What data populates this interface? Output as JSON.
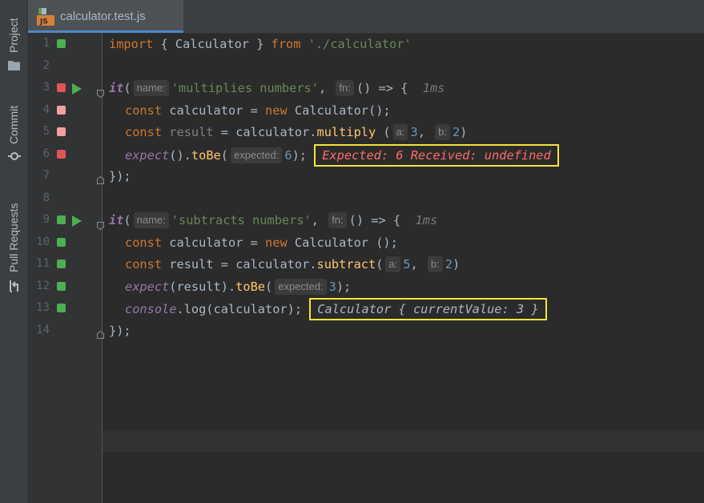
{
  "sidebar": {
    "tabs": [
      {
        "label": "Project",
        "icon": "folder-icon"
      },
      {
        "label": "Commit",
        "icon": "commit-icon"
      },
      {
        "label": "Pull Requests",
        "icon": "pull-request-icon"
      }
    ]
  },
  "tabs": [
    {
      "label": "calculator.test.js",
      "icon": "js-file-icon",
      "active": true
    }
  ],
  "gutter": {
    "lines": [
      {
        "num": "1",
        "status": "pass"
      },
      {
        "num": "2",
        "status": "none"
      },
      {
        "num": "3",
        "status": "fail",
        "run": true
      },
      {
        "num": "4",
        "status": "fail-light"
      },
      {
        "num": "5",
        "status": "fail-light"
      },
      {
        "num": "6",
        "status": "fail"
      },
      {
        "num": "7",
        "status": "none"
      },
      {
        "num": "8",
        "status": "none"
      },
      {
        "num": "9",
        "status": "pass",
        "run": true
      },
      {
        "num": "10",
        "status": "pass"
      },
      {
        "num": "11",
        "status": "pass"
      },
      {
        "num": "12",
        "status": "pass"
      },
      {
        "num": "13",
        "status": "pass"
      },
      {
        "num": "14",
        "status": "none"
      }
    ]
  },
  "code": {
    "l1": {
      "kw_import": "import",
      "braces": "{ Calculator }",
      "kw_from": "from",
      "path": "'./calculator'"
    },
    "l3": {
      "it": "it",
      "hint_name": "name:",
      "name": "'multiplies numbers'",
      "hint_fn": "fn:",
      "arrow": "() => {",
      "timing": "1ms"
    },
    "l4": {
      "kw": "const",
      "ident": "calculator",
      "eq": "=",
      "kw_new": "new",
      "call": "Calculator();"
    },
    "l5": {
      "kw": "const",
      "ident": "result",
      "eq": "=",
      "obj": "calculator.",
      "method": "multiply",
      "open": " (",
      "hint_a": "a:",
      "a": "3",
      "hint_b": "b:",
      "b": "2",
      "close": ")"
    },
    "l6": {
      "expect": "expect",
      "mid": "().",
      "tobe": "toBe",
      "open": "(",
      "hint_expected": "expected:",
      "val": "6",
      "close": ");",
      "result": "Expected: 6 Received: undefined"
    },
    "l7": {
      "text": "});"
    },
    "l9": {
      "it": "it",
      "hint_name": "name:",
      "name": "'subtracts numbers'",
      "hint_fn": "fn:",
      "arrow": "() => {",
      "timing": "1ms"
    },
    "l10": {
      "kw": "const",
      "ident": "calculator",
      "eq": "=",
      "kw_new": "new",
      "call": "Calculator ();"
    },
    "l11": {
      "kw": "const",
      "ident": "result",
      "eq": "=",
      "obj": "calculator.",
      "method": "subtract",
      "open": "(",
      "hint_a": "a:",
      "a": "5",
      "hint_b": "b:",
      "b": "2",
      "close": ")"
    },
    "l12": {
      "expect": "expect",
      "mid": "(result).",
      "tobe": "toBe",
      "open": "(",
      "hint_expected": "expected:",
      "val": "3",
      "close": ");"
    },
    "l13": {
      "console": "console",
      "mid": ".log(calculator);",
      "result": "Calculator { currentValue: 3 }"
    },
    "l14": {
      "text": "});"
    }
  },
  "colors": {
    "pass": "#4caf50",
    "fail": "#e05555",
    "fail_light": "#f2a0a0",
    "highlight_box": "#f5e33b"
  }
}
